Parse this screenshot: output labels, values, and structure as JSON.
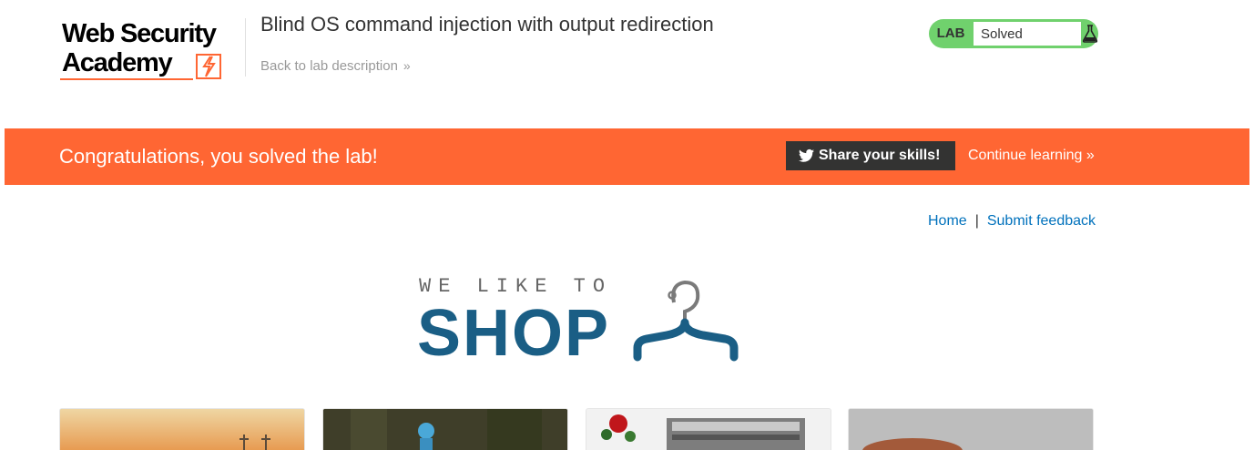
{
  "header": {
    "logo_line1": "Web Security",
    "logo_line2": "Academy",
    "lab_title": "Blind OS command injection with output redirection",
    "back_link": "Back to lab description",
    "lab_tag": "LAB",
    "lab_status": "Solved"
  },
  "banner": {
    "message": "Congratulations, you solved the lab!",
    "share_label": "Share your skills!",
    "continue_label": "Continue learning"
  },
  "nav": {
    "home": "Home",
    "separator": "|",
    "feedback": "Submit feedback"
  },
  "shop_logo": {
    "tagline": "WE LIKE TO",
    "word": "SHOP"
  },
  "products": [
    {
      "image": "sunset-crosses"
    },
    {
      "image": "blue-figure-forest"
    },
    {
      "image": "roses-typewriter"
    },
    {
      "image": "hand-closeup"
    }
  ],
  "colors": {
    "brand_orange": "#ff6633",
    "status_green": "#70d16d",
    "link_blue": "#0071bc",
    "shop_blue": "#1a5e85"
  }
}
